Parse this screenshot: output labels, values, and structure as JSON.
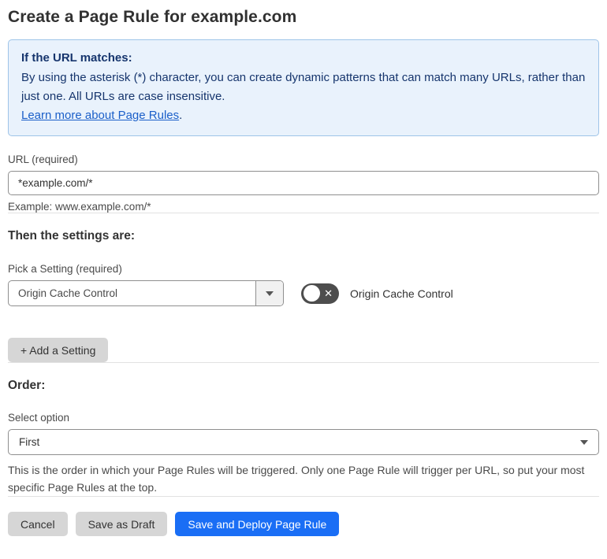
{
  "page_title": "Create a Page Rule for example.com",
  "colors": {
    "info_bg": "#e9f2fc",
    "info_border": "#9ec4e8",
    "info_text": "#16356d",
    "link_blue": "#1b5fc9",
    "primary_button_blue": "#1a6ef5",
    "gray_button": "#d6d6d6",
    "toggle_off_bg": "#4d4d4d"
  },
  "info_box": {
    "heading": "If the URL matches:",
    "body": "By using the asterisk (*) character, you can create dynamic patterns that can match many URLs, rather than just one. All URLs are case insensitive.",
    "link_label": "Learn more about Page Rules",
    "link_suffix": "."
  },
  "url_field": {
    "label": "URL (required)",
    "value": "*example.com/*",
    "helper": "Example: www.example.com/*"
  },
  "settings_section": {
    "heading": "Then the settings are:",
    "picker_label": "Pick a Setting (required)",
    "picker_value": "Origin Cache Control",
    "toggle_label": "Origin Cache Control",
    "toggle_state": "off",
    "toggle_off_glyph": "✕",
    "add_button_label": "+ Add a Setting"
  },
  "order_section": {
    "heading": "Order:",
    "select_label": "Select option",
    "select_value": "First",
    "helper": "This is the order in which your Page Rules will be triggered. Only one Page Rule will trigger per URL, so put your most specific Page Rules at the top."
  },
  "footer": {
    "cancel_label": "Cancel",
    "save_draft_label": "Save as Draft",
    "save_deploy_label": "Save and Deploy Page Rule"
  }
}
